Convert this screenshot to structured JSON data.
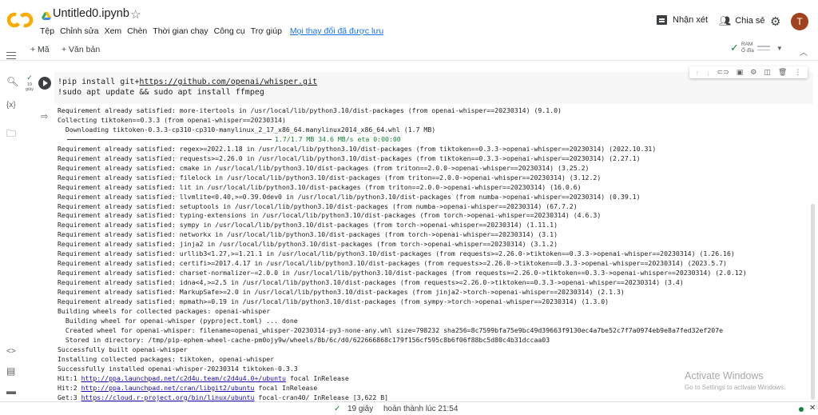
{
  "header": {
    "notebook_title": "Untitled0.ipynb",
    "menu": [
      "Tệp",
      "Chỉnh sửa",
      "Xem",
      "Chèn",
      "Thời gian chạy",
      "Công cụ",
      "Trợ giúp"
    ],
    "last_edit": "Mọi thay đổi đã được lưu",
    "comment_label": "Nhận xét",
    "share_label": "Chia sẻ",
    "avatar_initial": "T"
  },
  "toolbar": {
    "add_code": "+ Mã",
    "add_text": "+ Văn bản",
    "ram_label": "RAM",
    "disk_label": "Ổ đĩa"
  },
  "sidebar": {
    "code_icon_text": "{x}"
  },
  "cell": {
    "exec_time": "19 giây",
    "code_line1_prefix": "!pip install git+",
    "code_line1_url": "https://github.com/openai/whisper.git",
    "code_line2": "!sudo apt update && sudo apt install ffmpeg"
  },
  "output": {
    "lines_before": [
      "Requirement already satisfied: more-itertools in /usr/local/lib/python3.10/dist-packages (from openai-whisper==20230314) (9.1.0)",
      "Collecting tiktoken==0.3.3 (from openai-whisper==20230314)",
      "  Downloading tiktoken-0.3.3-cp310-cp310-manylinux_2_17_x86_64.manylinux2014_x86_64.whl (1.7 MB)"
    ],
    "progress_text": "1.7/1.7 MB 34.6 MB/s eta 0:00:00",
    "lines_after": [
      "Requirement already satisfied: regex>=2022.1.18 in /usr/local/lib/python3.10/dist-packages (from tiktoken==0.3.3->openai-whisper==20230314) (2022.10.31)",
      "Requirement already satisfied: requests>=2.26.0 in /usr/local/lib/python3.10/dist-packages (from tiktoken==0.3.3->openai-whisper==20230314) (2.27.1)",
      "Requirement already satisfied: cmake in /usr/local/lib/python3.10/dist-packages (from triton==2.0.0->openai-whisper==20230314) (3.25.2)",
      "Requirement already satisfied: filelock in /usr/local/lib/python3.10/dist-packages (from triton==2.0.0->openai-whisper==20230314) (3.12.2)",
      "Requirement already satisfied: lit in /usr/local/lib/python3.10/dist-packages (from triton==2.0.0->openai-whisper==20230314) (16.0.6)",
      "Requirement already satisfied: llvmlite<0.40,>=0.39.0dev0 in /usr/local/lib/python3.10/dist-packages (from numba->openai-whisper==20230314) (0.39.1)",
      "Requirement already satisfied: setuptools in /usr/local/lib/python3.10/dist-packages (from numba->openai-whisper==20230314) (67.7.2)",
      "Requirement already satisfied: typing-extensions in /usr/local/lib/python3.10/dist-packages (from torch->openai-whisper==20230314) (4.6.3)",
      "Requirement already satisfied: sympy in /usr/local/lib/python3.10/dist-packages (from torch->openai-whisper==20230314) (1.11.1)",
      "Requirement already satisfied: networkx in /usr/local/lib/python3.10/dist-packages (from torch->openai-whisper==20230314) (3.1)",
      "Requirement already satisfied: jinja2 in /usr/local/lib/python3.10/dist-packages (from torch->openai-whisper==20230314) (3.1.2)",
      "Requirement already satisfied: urllib3<1.27,>=1.21.1 in /usr/local/lib/python3.10/dist-packages (from requests>=2.26.0->tiktoken==0.3.3->openai-whisper==20230314) (1.26.16)",
      "Requirement already satisfied: certifi>=2017.4.17 in /usr/local/lib/python3.10/dist-packages (from requests>=2.26.0->tiktoken==0.3.3->openai-whisper==20230314) (2023.5.7)",
      "Requirement already satisfied: charset-normalizer~=2.0.0 in /usr/local/lib/python3.10/dist-packages (from requests>=2.26.0->tiktoken==0.3.3->openai-whisper==20230314) (2.0.12)",
      "Requirement already satisfied: idna<4,>=2.5 in /usr/local/lib/python3.10/dist-packages (from requests>=2.26.0->tiktoken==0.3.3->openai-whisper==20230314) (3.4)",
      "Requirement already satisfied: MarkupSafe>=2.0 in /usr/local/lib/python3.10/dist-packages (from jinja2->torch->openai-whisper==20230314) (2.1.3)",
      "Requirement already satisfied: mpmath>=0.19 in /usr/local/lib/python3.10/dist-packages (from sympy->torch->openai-whisper==20230314) (1.3.0)",
      "Building wheels for collected packages: openai-whisper",
      "  Building wheel for openai-whisper (pyproject.toml) ... done",
      "  Created wheel for openai-whisper: filename=openai_whisper-20230314-py3-none-any.whl size=798232 sha256=8c7599bfa75e9bc49d39663f9130ec4a7be52c7f7a0974eb9e8a7fed32ef207e",
      "  Stored in directory: /tmp/pip-ephem-wheel-cache-pm0ojy9w/wheels/8b/6c/d0/622666868c179f156cf595c8b6f06f88bc5d80c4b31dccaa03",
      "Successfully built openai-whisper",
      "Installing collected packages: tiktoken, openai-whisper",
      "Successfully installed openai-whisper-20230314 tiktoken-0.3.3"
    ],
    "apt_lines": [
      {
        "prefix": "Hit:1 ",
        "url": "http://ppa.launchpad.net/c2d4u.team/c2d4u4.0+/ubuntu",
        "suffix": " focal InRelease"
      },
      {
        "prefix": "Hit:2 ",
        "url": "http://ppa.launchpad.net/cran/libgit2/ubuntu",
        "suffix": " focal InRelease"
      },
      {
        "prefix": "Get:3 ",
        "url": "https://cloud.r-project.org/bin/linux/ubuntu",
        "suffix": " focal-cran40/ InRelease [3,622 B]"
      }
    ]
  },
  "watermark": {
    "line1": "Activate Windows",
    "line2": "Go to Settings to activate Windows."
  },
  "statusbar": {
    "time": "19 giây",
    "completed": "hoàn thành lúc 21:54"
  }
}
